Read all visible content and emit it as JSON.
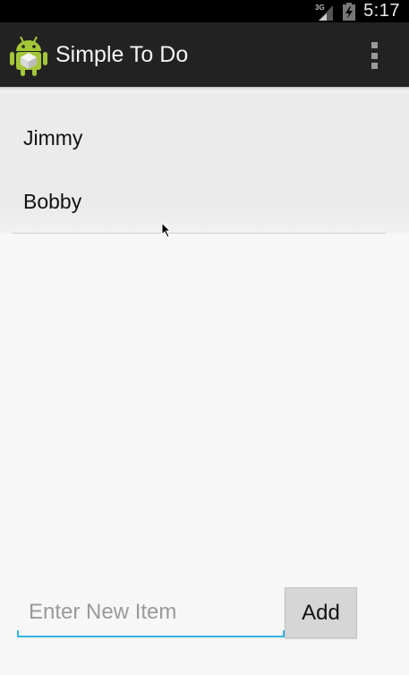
{
  "status_bar": {
    "network_label": "3G",
    "time": "5:17",
    "icons": [
      "signal-3g-icon",
      "battery-charging-icon"
    ]
  },
  "action_bar": {
    "app_icon": "android-icon",
    "title": "Simple To Do",
    "menu_icon": "overflow-menu-icon"
  },
  "items": [
    {
      "label": "Jimmy"
    },
    {
      "label": "Bobby"
    }
  ],
  "new_item": {
    "value": "",
    "placeholder": "Enter New Item"
  },
  "add_button": {
    "label": "Add"
  },
  "colors": {
    "action_bar": "#222222",
    "accent": "#33b5e5",
    "android_green": "#a4c639",
    "background": "#f7f7f7"
  }
}
